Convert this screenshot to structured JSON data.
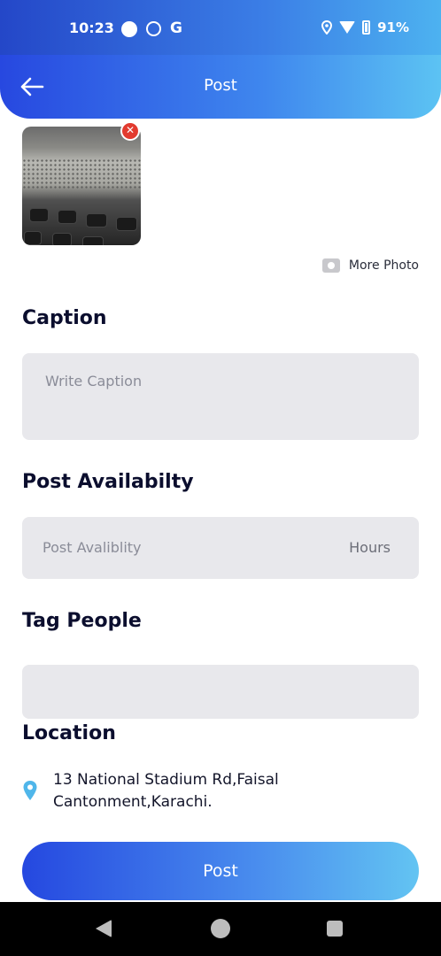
{
  "status_bar": {
    "time": "10:23",
    "g_label": "G",
    "battery": "91%",
    "icons": [
      "circle-notification-icon",
      "face-notification-icon",
      "google-icon",
      "location-icon",
      "wifi-icon",
      "battery-icon"
    ]
  },
  "app_bar": {
    "title": "Post",
    "back_icon": "arrow-left-icon"
  },
  "photo": {
    "remove_glyph": "✕",
    "remove_color": "#e23b2f"
  },
  "more_photo": {
    "label": "More Photo",
    "icon": "camera-icon"
  },
  "caption": {
    "label": "Caption",
    "placeholder": "Write Caption"
  },
  "availability": {
    "label": "Post Availabilty",
    "placeholder": "Post Avaliblity",
    "unit": "Hours"
  },
  "tag_people": {
    "label": "Tag People",
    "value": ""
  },
  "location": {
    "label": "Location",
    "address": "13 National Stadium Rd,Faisal Cantonment,Karachi.",
    "icon": "map-pin-icon",
    "pin_color": "#4fb6ea"
  },
  "post_button": {
    "label": "Post"
  },
  "colors": {
    "gradient_start": "#2548e0",
    "gradient_end": "#63c4f2",
    "field_bg": "#e8e8ec"
  },
  "nav_bar": {
    "icons": [
      "nav-back-icon",
      "nav-home-icon",
      "nav-recents-icon"
    ]
  }
}
